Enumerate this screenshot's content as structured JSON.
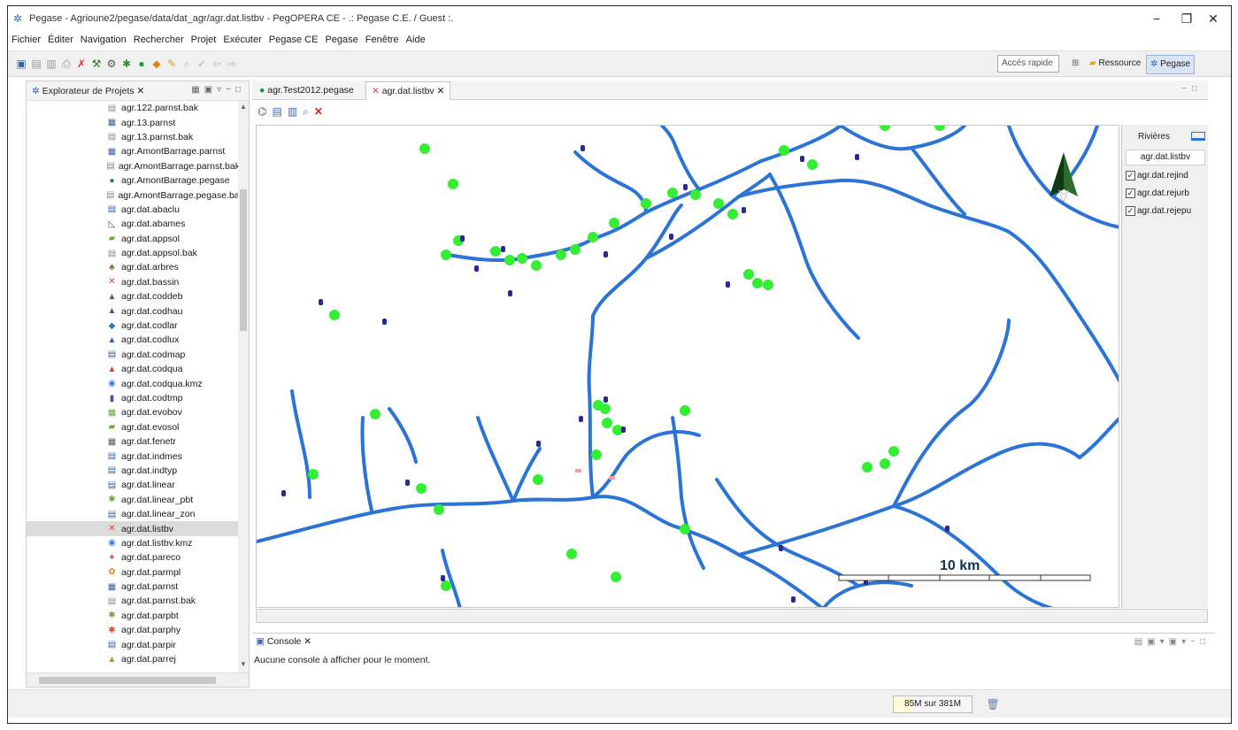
{
  "window": {
    "title": "Pegase - Agrioune2/pegase/data/dat_agr/agr.dat.listbv - PegOPERA CE - .: Pegase C.E. / Guest :.",
    "minimize": "−",
    "maximize": "❐",
    "close": "✕"
  },
  "menu": [
    "Fichier",
    "Éditer",
    "Navigation",
    "Rechercher",
    "Projet",
    "Exécuter",
    "Pegase CE",
    "Pegase",
    "Fenêtre",
    "Aide"
  ],
  "toolbar": {
    "quick_access": "Accès rapide",
    "perspective_ressource": "Ressource",
    "perspective_pegase": "Pegase"
  },
  "explorer": {
    "title": "Explorateur de Projets ✕",
    "items": [
      {
        "label": "agr.122.parnst.bak",
        "icon": "file-icon",
        "color": "#8a8a8a"
      },
      {
        "label": "agr.13.parnst",
        "icon": "params-icon",
        "color": "#3b5fa0"
      },
      {
        "label": "agr.13.parnst.bak",
        "icon": "file-icon",
        "color": "#8a8a8a"
      },
      {
        "label": "agr.AmontBarrage.parnst",
        "icon": "params-icon",
        "color": "#3b5fa0"
      },
      {
        "label": "agr.AmontBarrage.parnst.bak",
        "icon": "file-icon",
        "color": "#8a8a8a"
      },
      {
        "label": "agr.AmontBarrage.pegase",
        "icon": "pegase-icon",
        "color": "#1e8c3a"
      },
      {
        "label": "agr.AmontBarrage.pegase.bak",
        "icon": "file-icon",
        "color": "#8a8a8a"
      },
      {
        "label": "agr.dat.abaclu",
        "icon": "document-icon",
        "color": "#3b5fa0"
      },
      {
        "label": "agr.dat.abames",
        "icon": "chart-icon",
        "color": "#555555"
      },
      {
        "label": "agr.dat.appsol",
        "icon": "soil-icon",
        "color": "#6aa73f"
      },
      {
        "label": "agr.dat.appsol.bak",
        "icon": "file-icon",
        "color": "#8a8a8a"
      },
      {
        "label": "agr.dat.arbres",
        "icon": "tree-icon",
        "color": "#8a6d2e"
      },
      {
        "label": "agr.dat.bassin",
        "icon": "river-icon",
        "color": "#d9453b"
      },
      {
        "label": "agr.dat.coddeb",
        "icon": "station-icon",
        "color": "#3b5fa0"
      },
      {
        "label": "agr.dat.codhau",
        "icon": "height-icon",
        "color": "#3b5fa0"
      },
      {
        "label": "agr.dat.codlar",
        "icon": "width-icon",
        "color": "#2a7ab8"
      },
      {
        "label": "agr.dat.codlux",
        "icon": "light-icon",
        "color": "#3b5fa0"
      },
      {
        "label": "agr.dat.codmap",
        "icon": "document-icon",
        "color": "#3b5fa0"
      },
      {
        "label": "agr.dat.codqua",
        "icon": "quality-icon",
        "color": "#d9453b"
      },
      {
        "label": "agr.dat.codqua.kmz",
        "icon": "globe-icon",
        "color": "#3a7bd5"
      },
      {
        "label": "agr.dat.codtmp",
        "icon": "temperature-icon",
        "color": "#3b5fa0"
      },
      {
        "label": "agr.dat.evobov",
        "icon": "cattle-icon",
        "color": "#6aa73f"
      },
      {
        "label": "agr.dat.evosol",
        "icon": "soil-icon",
        "color": "#6aa73f"
      },
      {
        "label": "agr.dat.fenetr",
        "icon": "grid-icon",
        "color": "#555555"
      },
      {
        "label": "agr.dat.indmes",
        "icon": "document-icon",
        "color": "#3b5fa0"
      },
      {
        "label": "agr.dat.indtyp",
        "icon": "document-icon",
        "color": "#3b5fa0"
      },
      {
        "label": "agr.dat.linear",
        "icon": "document-icon",
        "color": "#3b5fa0"
      },
      {
        "label": "agr.dat.linear_pbt",
        "icon": "crop-icon",
        "color": "#6aa73f"
      },
      {
        "label": "agr.dat.linear_zon",
        "icon": "document-icon",
        "color": "#3b5fa0"
      },
      {
        "label": "agr.dat.listbv",
        "icon": "river-icon",
        "color": "#d9453b"
      },
      {
        "label": "agr.dat.listbv.kmz",
        "icon": "globe-icon",
        "color": "#3a7bd5"
      },
      {
        "label": "agr.dat.pareco",
        "icon": "eco-icon",
        "color": "#d9453b"
      },
      {
        "label": "agr.dat.parmpl",
        "icon": "plant-icon",
        "color": "#e08a1e"
      },
      {
        "label": "agr.dat.parnst",
        "icon": "params-icon",
        "color": "#3b5fa0"
      },
      {
        "label": "agr.dat.parnst.bak",
        "icon": "file-icon",
        "color": "#8a8a8a"
      },
      {
        "label": "agr.dat.parpbt",
        "icon": "crop-icon",
        "color": "#6aa73f"
      },
      {
        "label": "agr.dat.parphy",
        "icon": "phyto-icon",
        "color": "#d9453b"
      },
      {
        "label": "agr.dat.parpir",
        "icon": "document-icon",
        "color": "#3b5fa0"
      },
      {
        "label": "agr.dat.parrej",
        "icon": "discharge-icon",
        "color": "#c08a2e"
      }
    ],
    "selected_index": 29
  },
  "editor": {
    "tabs": [
      {
        "label": "agr.Test2012.pegase",
        "active": false
      },
      {
        "label": "agr.dat.listbv ✕",
        "active": true
      }
    ]
  },
  "map": {
    "scale_label": "10 km",
    "river_color": "#2b74d6",
    "point_color": "#33ee33",
    "marker_color": "#2a2a8a"
  },
  "legend": {
    "title": "Rivières",
    "layer": "agr.dat.listbv",
    "checks": [
      "agr.dat.rejind",
      "agr.dat.rejurb",
      "agr.dat.rejepu"
    ]
  },
  "console": {
    "tab": "Console ✕",
    "message": "Aucune console à afficher pour le moment."
  },
  "status": {
    "heap": "85M sur 381M"
  }
}
